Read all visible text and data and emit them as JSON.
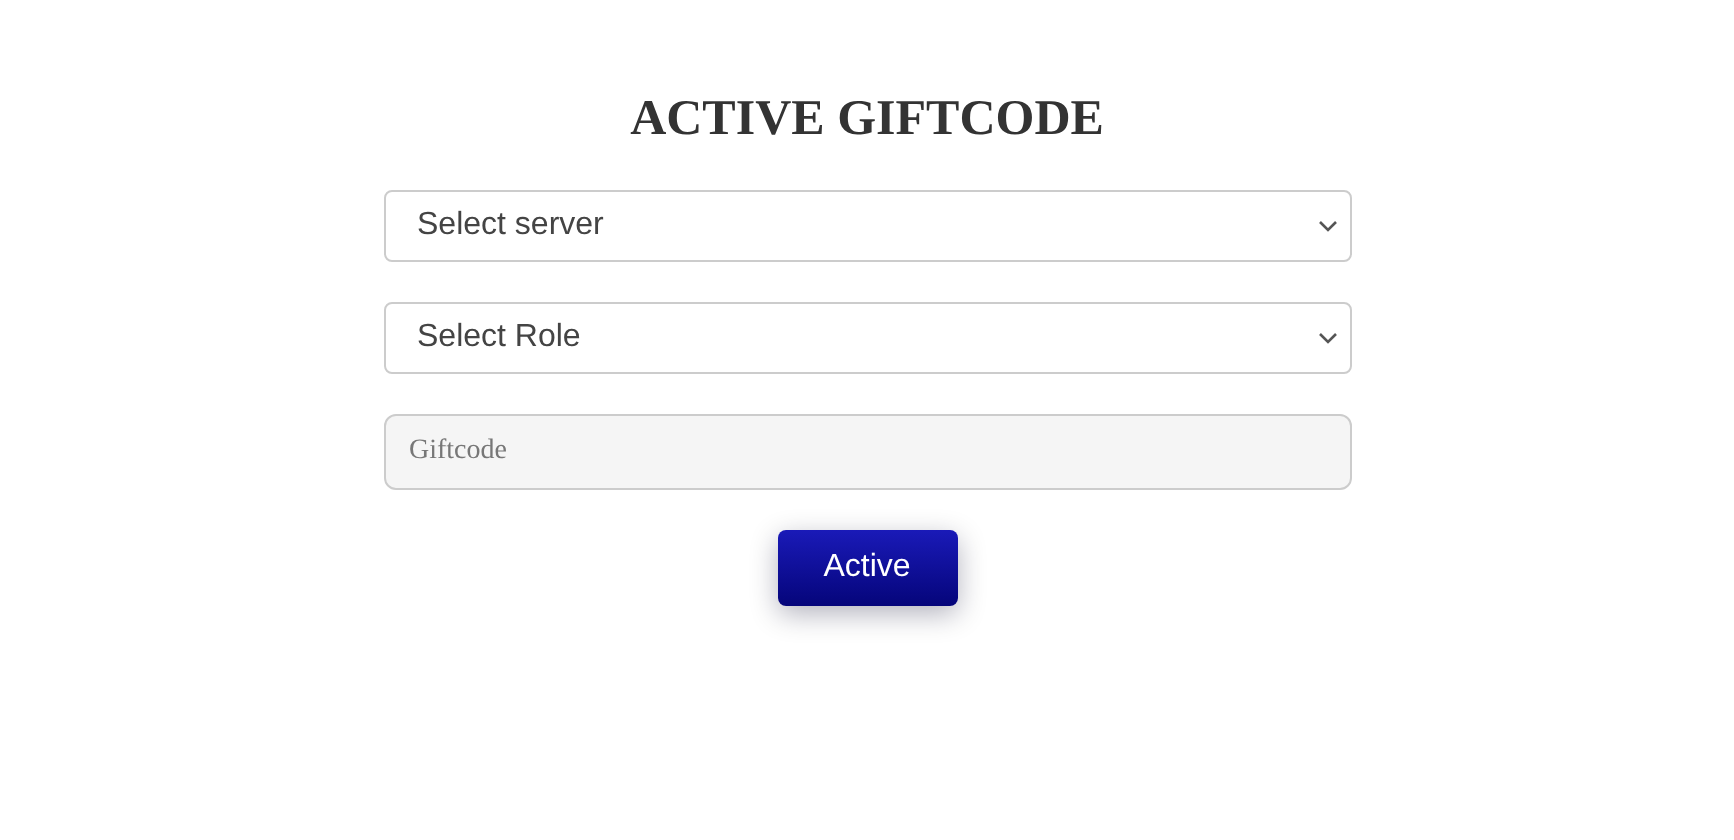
{
  "title": "ACTIVE GIFTCODE",
  "selects": [
    {
      "label": "Select server"
    },
    {
      "label": "Select Role"
    }
  ],
  "giftcode": {
    "placeholder": "Giftcode"
  },
  "button": "Active"
}
